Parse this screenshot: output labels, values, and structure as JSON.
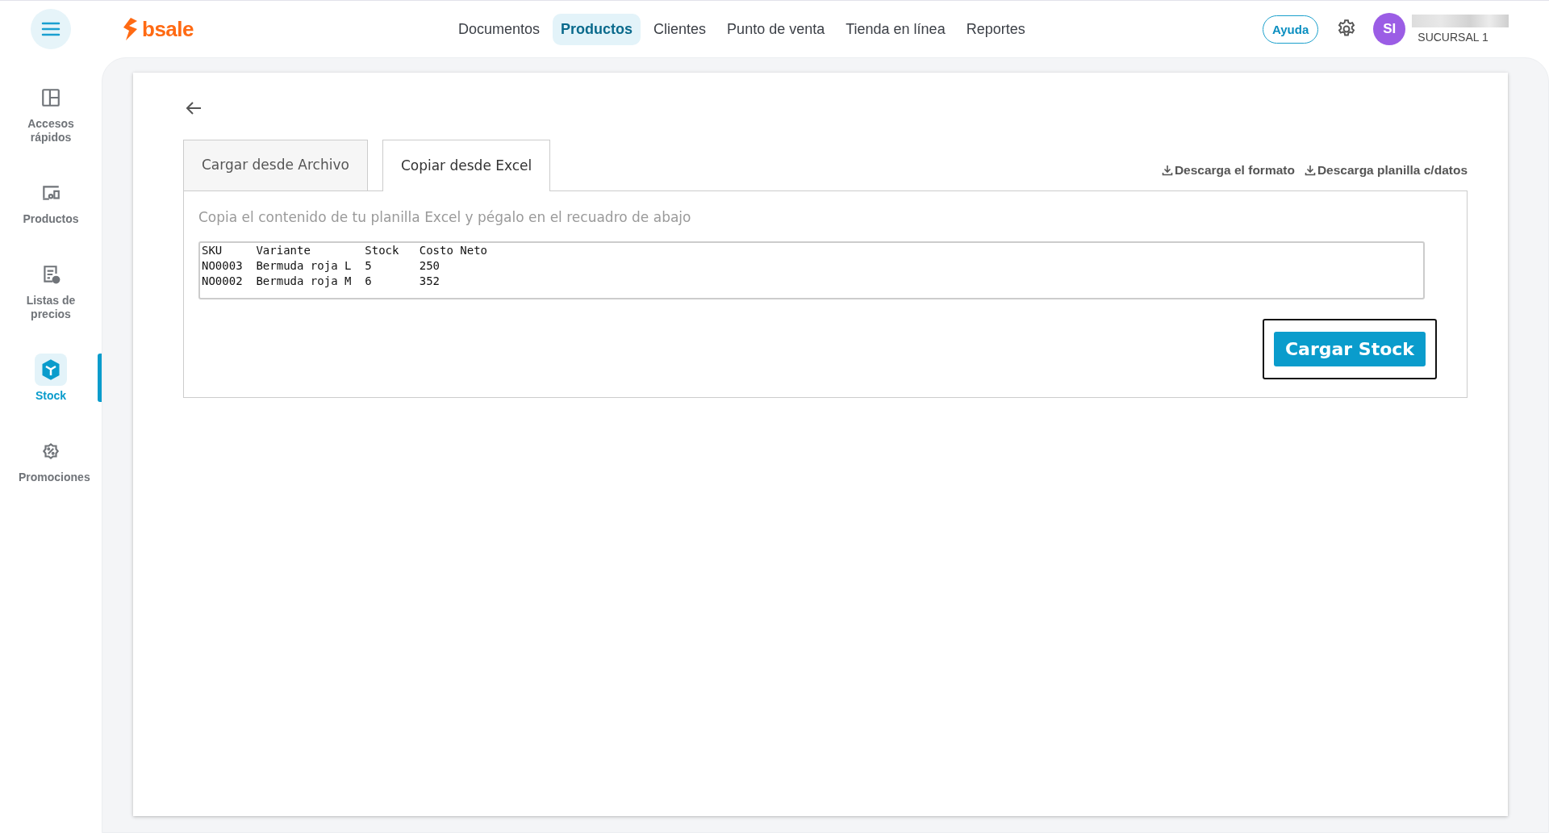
{
  "brand": {
    "name": "bsale"
  },
  "nav": [
    {
      "label": "Documentos",
      "selected": false
    },
    {
      "label": "Productos",
      "selected": true
    },
    {
      "label": "Clientes",
      "selected": false
    },
    {
      "label": "Punto de venta",
      "selected": false
    },
    {
      "label": "Tienda en línea",
      "selected": false
    },
    {
      "label": "Reportes",
      "selected": false
    }
  ],
  "help_button": "Ayuda",
  "user": {
    "initials": "SI",
    "branch": "SUCURSAL 1"
  },
  "sidebar": {
    "items": [
      {
        "label": "Accesos rápidos",
        "selected": false
      },
      {
        "label": "Productos",
        "selected": false
      },
      {
        "label": "Listas de precios",
        "selected": false
      },
      {
        "label": "Stock",
        "selected": true
      },
      {
        "label": "Promociones",
        "selected": false
      }
    ]
  },
  "tabs": [
    {
      "label": "Cargar desde Archivo",
      "selected": false
    },
    {
      "label": "Copiar desde Excel",
      "selected": true
    }
  ],
  "download_links": [
    "Descarga el formato",
    "Descarga planilla c/datos"
  ],
  "instructions": "Copia el contenido de tu planilla Excel y pégalo en el recuadro de abajo",
  "paste_field": {
    "value": "SKU\tVariante\tStock\tCosto Neto\nNO0003\tBermuda roja L\t5\t250\nNO0002\tBermuda roja M\t6\t352"
  },
  "submit_button": "Cargar Stock"
}
